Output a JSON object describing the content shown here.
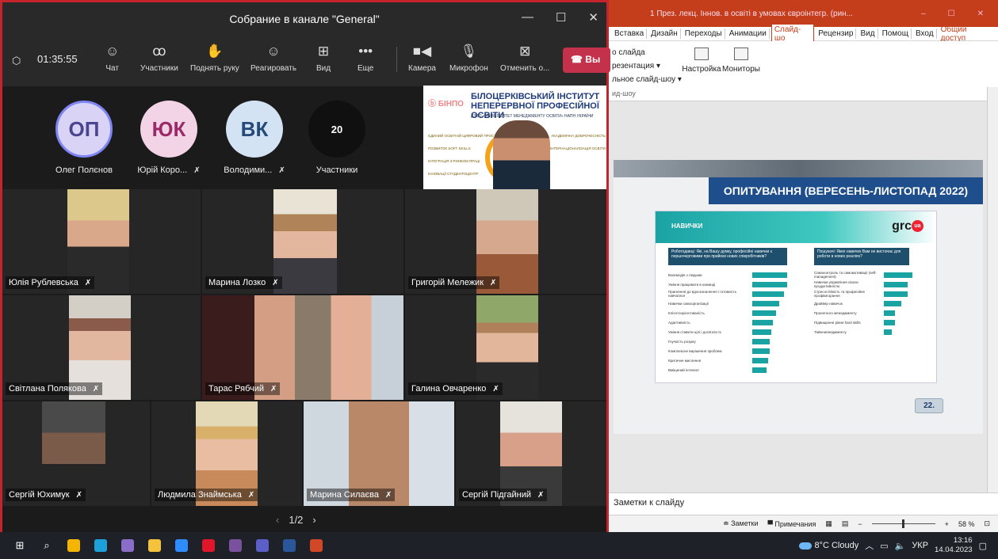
{
  "teams": {
    "title": "Собрание в канале \"General\"",
    "timer": "01:35:55",
    "toolbar": {
      "chat": "Чат",
      "participants": "Участники",
      "raise_hand": "Поднять руку",
      "react": "Реагировать",
      "view": "Вид",
      "more": "Еще",
      "camera": "Камера",
      "mic": "Микрофон",
      "cancel": "Отменить о...",
      "leave": "Вы"
    },
    "avatars": [
      {
        "initials": "ОП",
        "name": "Олег Полєнов",
        "color": "#d9d4f5",
        "text_color": "#4b4590"
      },
      {
        "initials": "ЮК",
        "name": "Юрій Коро...",
        "color": "#f3d4e6",
        "text_color": "#9a2a6a"
      },
      {
        "initials": "ВК",
        "name": "Володими...",
        "color": "#d4e3f3",
        "text_color": "#254a7a"
      }
    ],
    "others": {
      "count": "20",
      "label": "Участники"
    },
    "presenter": {
      "logo": "ⓑ БІНПО",
      "heading1": "БІЛОЦЕРКІВСЬКИЙ ІНСТИТУТ",
      "heading2": "НЕПЕРЕРВНОЇ ПРОФЕСІЙНОЇ ОСВІТИ",
      "subheading": "ДЗВО «УНІВЕРСИТЕТ МЕНЕДЖМЕНТУ ОСВІТИ» НАПН УКРАЇНИ",
      "chips_left": [
        "ЄДИНИЙ ОСВІТНІЙ ЦИФРОВИЙ ПРОСТІР",
        "РОЗВИТОК SOFT SKILLS",
        "ІНТЕГРАЦІЯ З РИНКОМ ПРАЦІ",
        "ІННОВАЦІЇ СТУДЕНТОЦЕНТР"
      ],
      "chips_right": [
        "АКАДЕМІЧНА ДОБРОЧЕСНІСТЬ",
        "ІНТЕРНАЦІОНАЛІЗАЦІЯ ОСВІТИ"
      ]
    },
    "tiles": [
      {
        "name": "Юлія Рублевська"
      },
      {
        "name": "Марина Лозко"
      },
      {
        "name": "Григорій Мележик"
      },
      {
        "name": "Світлана Полякова"
      },
      {
        "name": "Тарас Рябчий"
      },
      {
        "name": "Галина Овчаренко"
      },
      {
        "name": "Сергій Юхимук"
      },
      {
        "name": "Людмила Знаймська"
      },
      {
        "name": "Марина Силаєва"
      },
      {
        "name": "Сергій Підгайний"
      }
    ],
    "pager": {
      "prev": "‹",
      "page": "1/2",
      "next": "›"
    }
  },
  "ppt": {
    "title": "1 През. лекц. Іннов. в освіті в умовах євроінтегр. (рин...",
    "tabs": [
      "Вставка",
      "Дизайн",
      "Переходы",
      "Анимации",
      "Слайд-шо",
      "Рецензир",
      "Вид",
      "Помощ",
      "Вход"
    ],
    "active_tab": "Слайд-шо",
    "share": "Общий доступ",
    "ribbon_list": [
      "о слайда",
      "резентация ▾",
      "льное слайд-шоу ▾"
    ],
    "ribbon_group": "ид-шоу",
    "btn_setup": "Настройка",
    "btn_monitors": "Мониторы",
    "slide": {
      "banner": "ОПИТУВАННЯ (ВЕРЕСЕНЬ-ЛИСТОПАД 2022)",
      "section": "НАВИЧКИ",
      "logo": "grc",
      "logo_badge": "ua",
      "q1": "Роботодавці: Які, на Вашу думку, професійні навички є першочерговими при прийомі нових співробітників?",
      "q2": "Пошукачі: Яких навичок Вам не вистачає для роботи в нових реаліях?",
      "left_items": [
        "Взаємодія з людьми",
        "Уміння працювати в команді",
        "Прагнення до вдосконалення і готовність навчатися",
        "Навички самоорганізації",
        "Клієнтоорієнтованість",
        "Адаптивність",
        "Уміння ставити цілі і досягати їх",
        "Гнучкість розуму",
        "Комплексне вирішення проблем",
        "Критичне мислення",
        "Вміщений інтелект"
      ],
      "right_items": [
        "Самоконтроль та самомотивації (self-management)",
        "Навички управління своєю продуктивністю",
        "Стресостійкість та професійне профвигорання",
        "Драйвер навичок",
        "Проектного менеджменту",
        "Підвищення рівня hard skills",
        "Тайм-менеджменту"
      ],
      "page": "22."
    },
    "notes": "Заметки к слайду",
    "status": {
      "notes_btn": "≐ Заметки",
      "comments_btn": "▀ Примечания",
      "zoom": "58 %"
    }
  },
  "taskbar": {
    "weather": "8°C Cloudy",
    "lang": "УКР",
    "time": "13:16",
    "date": "14.04.2023",
    "apps": [
      {
        "name": "start",
        "glyph": "⊞",
        "color": "#ffffff"
      },
      {
        "name": "search",
        "glyph": "⌕",
        "color": "#ffffff"
      },
      {
        "name": "chrome",
        "glyph": "",
        "color": "#f4b400"
      },
      {
        "name": "edge",
        "glyph": "",
        "color": "#1ea0db"
      },
      {
        "name": "photos",
        "glyph": "",
        "color": "#8a6cc9"
      },
      {
        "name": "explorer",
        "glyph": "",
        "color": "#f5c33b"
      },
      {
        "name": "zoom",
        "glyph": "",
        "color": "#2d8cff"
      },
      {
        "name": "opera",
        "glyph": "",
        "color": "#e0162b"
      },
      {
        "name": "viber",
        "glyph": "",
        "color": "#7b519d"
      },
      {
        "name": "teams",
        "glyph": "",
        "color": "#5b5fc7"
      },
      {
        "name": "word",
        "glyph": "",
        "color": "#2b579a"
      },
      {
        "name": "powerpoint",
        "glyph": "",
        "color": "#d24726"
      }
    ]
  }
}
